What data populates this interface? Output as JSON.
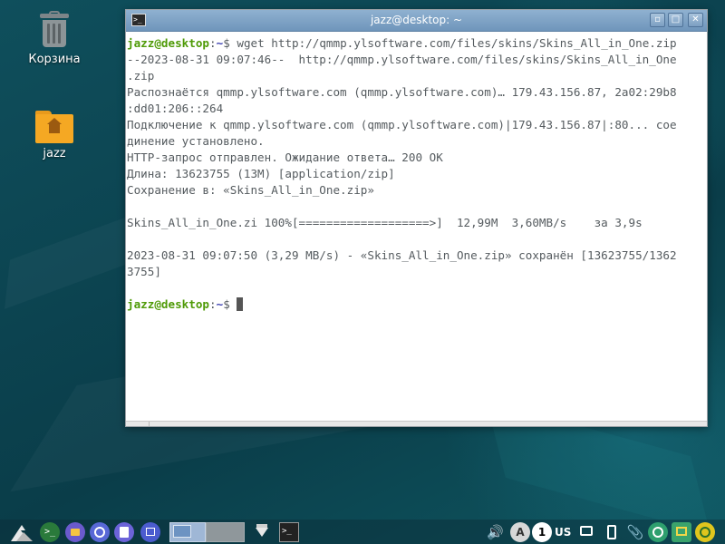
{
  "desktop": {
    "icons": [
      {
        "label": "Корзина",
        "icon": "trash-icon"
      },
      {
        "label": "jazz",
        "icon": "home-folder-icon"
      }
    ]
  },
  "window": {
    "title": "jazz@desktop: ~",
    "app_icon_text": ">_",
    "buttons": {
      "minimize": "▫",
      "maximize": "□",
      "close": "✕"
    }
  },
  "terminal": {
    "prompt_user": "jazz@desktop",
    "prompt_sep": ":",
    "prompt_path": "~",
    "prompt_symbol": "$",
    "command": " wget http://qmmp.ylsoftware.com/files/skins/Skins_All_in_One.zip",
    "lines": [
      "--2023-08-31 09:07:46--  http://qmmp.ylsoftware.com/files/skins/Skins_All_in_One",
      ".zip",
      "Распознаётся qmmp.ylsoftware.com (qmmp.ylsoftware.com)… 179.43.156.87, 2a02:29b8",
      ":dd01:206::264",
      "Подключение к qmmp.ylsoftware.com (qmmp.ylsoftware.com)|179.43.156.87|:80... сое",
      "динение установлено.",
      "HTTP-запрос отправлен. Ожидание ответа… 200 OK",
      "Длина: 13623755 (13M) [application/zip]",
      "Сохранение в: «Skins_All_in_One.zip»",
      "",
      "Skins_All_in_One.zi 100%[===================>]  12,99M  3,60MB/s    за 3,9s",
      "",
      "2023-08-31 09:07:50 (3,29 MB/s) - «Skins_All_in_One.zip» сохранён [13623755/1362",
      "3755]",
      ""
    ]
  },
  "taskbar": {
    "terminal_label": ">_",
    "task_terminal_label": ">_",
    "volume_glyph": "🔊",
    "a11y_label": "A",
    "notifications_count": "1",
    "keyboard_layout": "US",
    "clip_glyph": "📎"
  },
  "colors": {
    "prompt_user": "#4e9a06",
    "prompt_path": "#3a3fb0",
    "titlebar": "#7fa3c6",
    "desktop_bg": "#0c4451"
  }
}
